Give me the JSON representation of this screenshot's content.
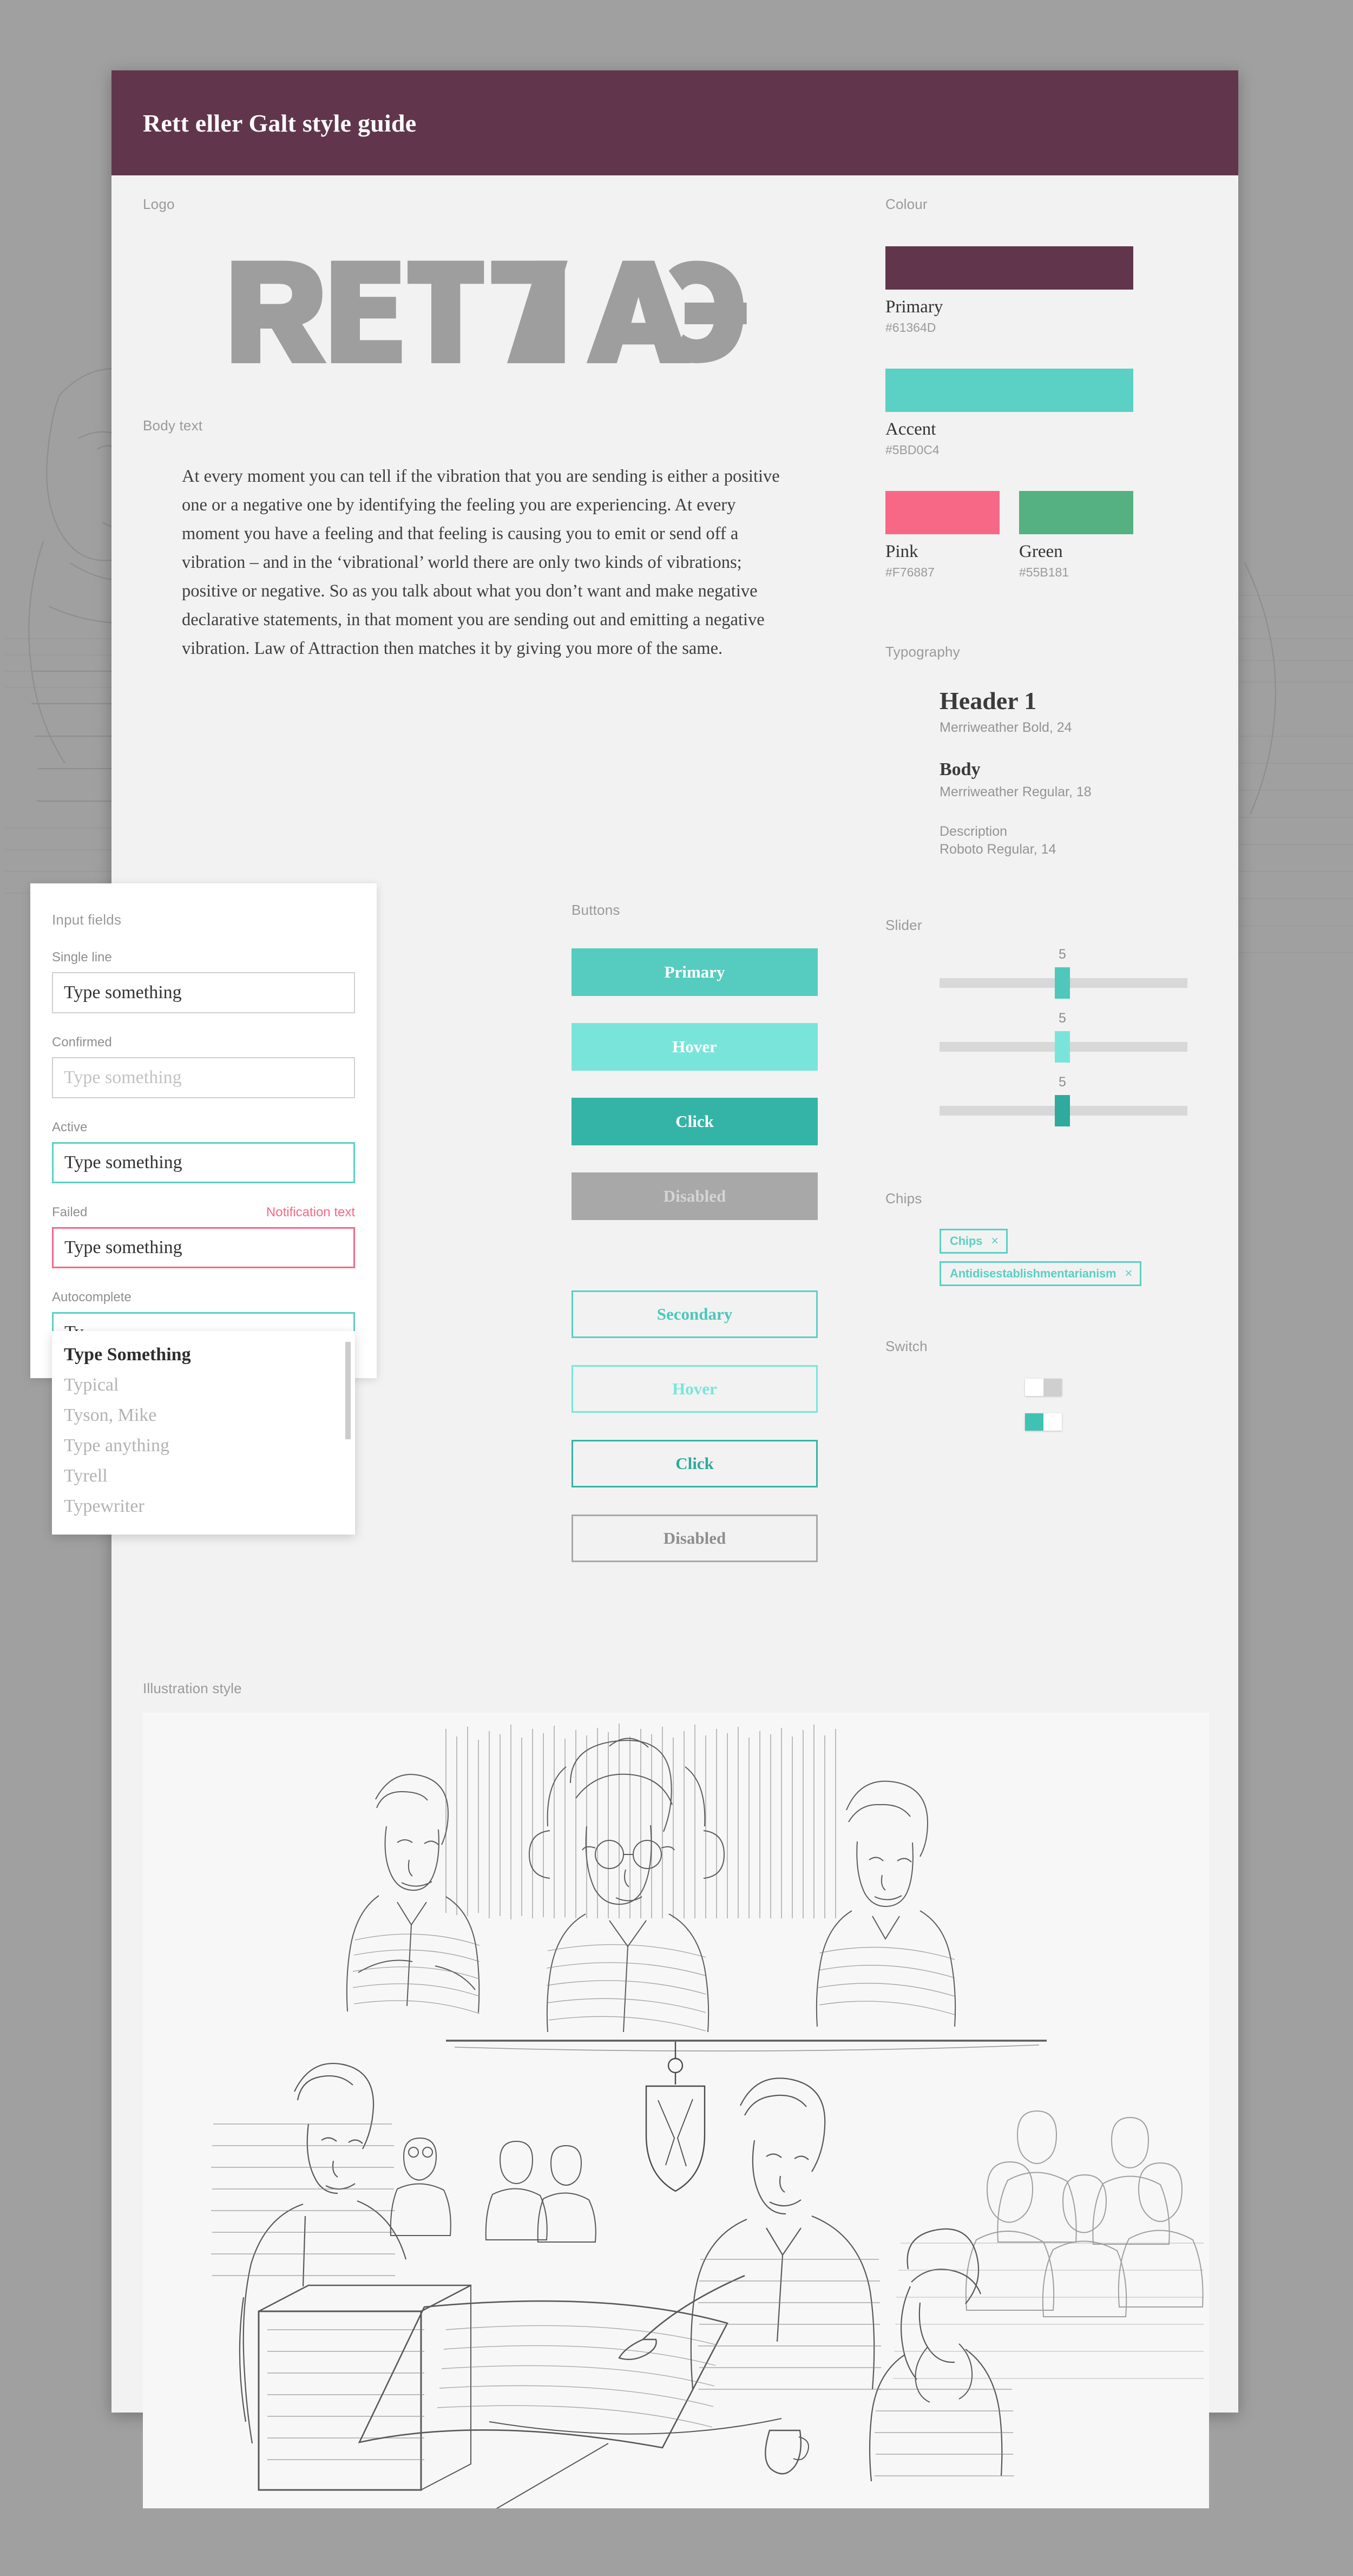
{
  "header": {
    "title": "Rett eller Galt style guide"
  },
  "sections": {
    "logo": "Logo",
    "body_text": "Body text",
    "colour": "Colour",
    "typography": "Typography",
    "slider": "Slider",
    "chips": "Chips",
    "switch": "Switch",
    "input_fields": "Input fields",
    "buttons": "Buttons",
    "illustration": "Illustration style"
  },
  "logo": {
    "text": "RETT GALT",
    "color": "#9e9e9e"
  },
  "body_text": {
    "paragraph": "At every moment you can tell if the vibration that you are sending is either a positive one or a negative one by identifying the feeling you are experiencing. At every moment you have a feeling and that feeling is causing you to emit or send off a vibration – and in the ‘vibrational’ world there are only two kinds of vibrations; positive or negative. So as you talk about what you don’t want and make negative declarative statements, in that moment you are sending out and emitting a negative vibration. Law of Attraction then matches it by giving you more of the same."
  },
  "colours": [
    {
      "name": "Primary",
      "hex": "#61364D"
    },
    {
      "name": "Accent",
      "hex": "#5BD0C4"
    },
    {
      "name": "Pink",
      "hex": "#F76887"
    },
    {
      "name": "Green",
      "hex": "#55B181"
    }
  ],
  "typography": {
    "header1": {
      "sample": "Header 1",
      "spec": "Merriweather Bold, 24"
    },
    "body": {
      "sample": "Body",
      "spec": "Merriweather Regular, 18"
    },
    "description": {
      "sample": "Description",
      "spec": "Roboto Regular, 14"
    }
  },
  "sliders": [
    {
      "value": "5",
      "state": "default",
      "color": "#4FC8BB"
    },
    {
      "value": "5",
      "state": "hover",
      "color": "#79E5DA"
    },
    {
      "value": "5",
      "state": "active",
      "color": "#2FAA9D"
    }
  ],
  "chips": [
    {
      "label": "Chips",
      "close": "×"
    },
    {
      "label": "Antidisestablishmentarianism",
      "close": "×"
    }
  ],
  "switches": [
    {
      "state": "off",
      "knob": "#ffffff",
      "track": "#cfcfcf"
    },
    {
      "state": "on",
      "knob": "#ffffff",
      "track": "#3fc2b3"
    }
  ],
  "input_fields": [
    {
      "label": "Single line",
      "value": "Type something",
      "state": "default",
      "note": ""
    },
    {
      "label": "Confirmed",
      "value": "Type something",
      "state": "placeholder",
      "note": ""
    },
    {
      "label": "Active",
      "value": "Type something",
      "state": "active",
      "note": ""
    },
    {
      "label": "Failed",
      "value": "Type something",
      "state": "failed",
      "note": "Notification text"
    },
    {
      "label": "Autocomplete",
      "value": "Ty",
      "state": "active",
      "note": ""
    }
  ],
  "autocomplete_options": [
    "Type Something",
    "Typical",
    "Tyson, Mike",
    "Type anything",
    "Tyrell",
    "Typewriter"
  ],
  "buttons": {
    "primary": [
      {
        "label": "Primary",
        "state": "default",
        "bg": "#55CCBF"
      },
      {
        "label": "Hover",
        "state": "hover",
        "bg": "#79E5DA"
      },
      {
        "label": "Click",
        "state": "click",
        "bg": "#34B4A6"
      },
      {
        "label": "Disabled",
        "state": "disabled",
        "bg": "#a8a8a8"
      }
    ],
    "secondary": [
      {
        "label": "Secondary",
        "state": "default",
        "border": "#5BD0C4"
      },
      {
        "label": "Hover",
        "state": "hover",
        "border": "#79E5DA"
      },
      {
        "label": "Click",
        "state": "click",
        "border": "#34B4A6"
      },
      {
        "label": "Disabled",
        "state": "disabled",
        "border": "#a8a8a8"
      }
    ]
  }
}
